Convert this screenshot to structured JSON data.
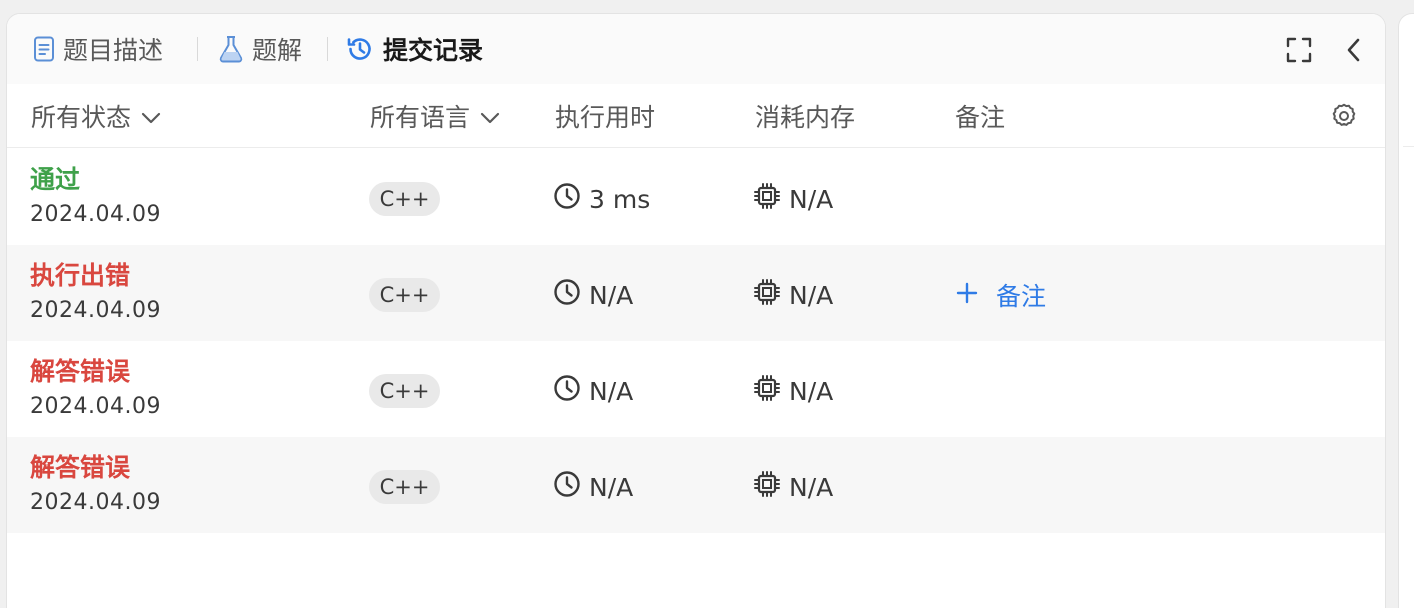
{
  "tabs": [
    {
      "label": "题目描述",
      "icon": "document-icon",
      "active": false
    },
    {
      "label": "题解",
      "icon": "flask-icon",
      "active": false
    },
    {
      "label": "提交记录",
      "icon": "history-icon",
      "active": true
    }
  ],
  "header": {
    "status_filter": "所有状态",
    "language_filter": "所有语言",
    "runtime": "执行用时",
    "memory": "消耗内存",
    "notes": "备注"
  },
  "submissions": [
    {
      "status": "通过",
      "status_color": "#3fa14a",
      "date": "2024.04.09",
      "language": "C++",
      "runtime": "3 ms",
      "memory": "N/A",
      "note": ""
    },
    {
      "status": "执行出错",
      "status_color": "#d9473f",
      "date": "2024.04.09",
      "language": "C++",
      "runtime": "N/A",
      "memory": "N/A",
      "note": "备注"
    },
    {
      "status": "解答错误",
      "status_color": "#d9473f",
      "date": "2024.04.09",
      "language": "C++",
      "runtime": "N/A",
      "memory": "N/A",
      "note": ""
    },
    {
      "status": "解答错误",
      "status_color": "#d9473f",
      "date": "2024.04.09",
      "language": "C++",
      "runtime": "N/A",
      "memory": "N/A",
      "note": ""
    }
  ],
  "colors": {
    "accent": "#2f7be6",
    "success": "#3fa14a",
    "error": "#d9473f"
  }
}
